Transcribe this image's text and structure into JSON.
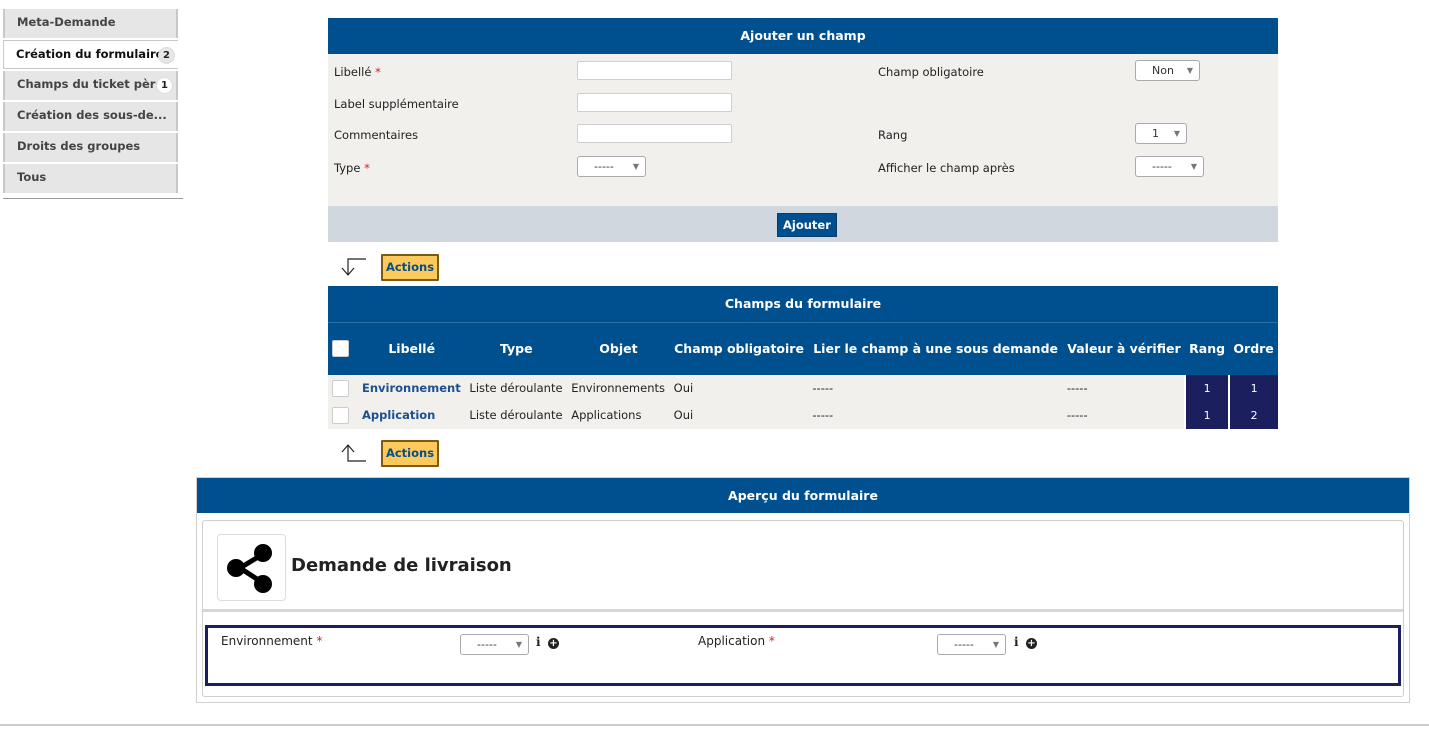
{
  "tabs": [
    {
      "label": "Meta-Demande",
      "badge": ""
    },
    {
      "label": "Création du formulaire",
      "badge": "2"
    },
    {
      "label": "Champs du ticket père",
      "badge": "1"
    },
    {
      "label": "Création des sous-de...",
      "badge": ""
    },
    {
      "label": "Droits des groupes",
      "badge": ""
    },
    {
      "label": "Tous",
      "badge": ""
    }
  ],
  "add_field": {
    "title": "Ajouter un champ",
    "label_libelle": "Libellé",
    "label_supp": "Label supplémentaire",
    "label_comment": "Commentaires",
    "label_type": "Type",
    "type_value": "-----",
    "label_obligatoire": "Champ obligatoire",
    "obligatoire_value": "Non",
    "label_rang": "Rang",
    "rang_value": "1",
    "label_after": "Afficher le champ après",
    "after_value": "-----",
    "required_mark": "*",
    "button": "Ajouter"
  },
  "actions_label": "Actions",
  "fields_table": {
    "title": "Champs du formulaire",
    "columns": [
      "Libellé",
      "Type",
      "Objet",
      "Champ obligatoire",
      "Lier le champ à une sous demande",
      "Valeur à vérifier",
      "Rang",
      "Ordre"
    ],
    "rows": [
      {
        "libelle": "Environnement",
        "type": "Liste déroulante",
        "objet": "Environnements",
        "obligatoire": "Oui",
        "lier": "-----",
        "valeur": "-----",
        "rang": "1",
        "ordre": "1"
      },
      {
        "libelle": "Application",
        "type": "Liste déroulante",
        "objet": "Applications",
        "obligatoire": "Oui",
        "lier": "-----",
        "valeur": "-----",
        "rang": "1",
        "ordre": "2"
      }
    ]
  },
  "preview": {
    "title": "Aperçu du formulaire",
    "form_name": "Demande de livraison",
    "fields": [
      {
        "label": "Environnement",
        "value": "-----"
      },
      {
        "label": "Application",
        "value": "-----"
      }
    ],
    "required_mark": "*",
    "info_glyph": "i",
    "plus_glyph": "+"
  }
}
